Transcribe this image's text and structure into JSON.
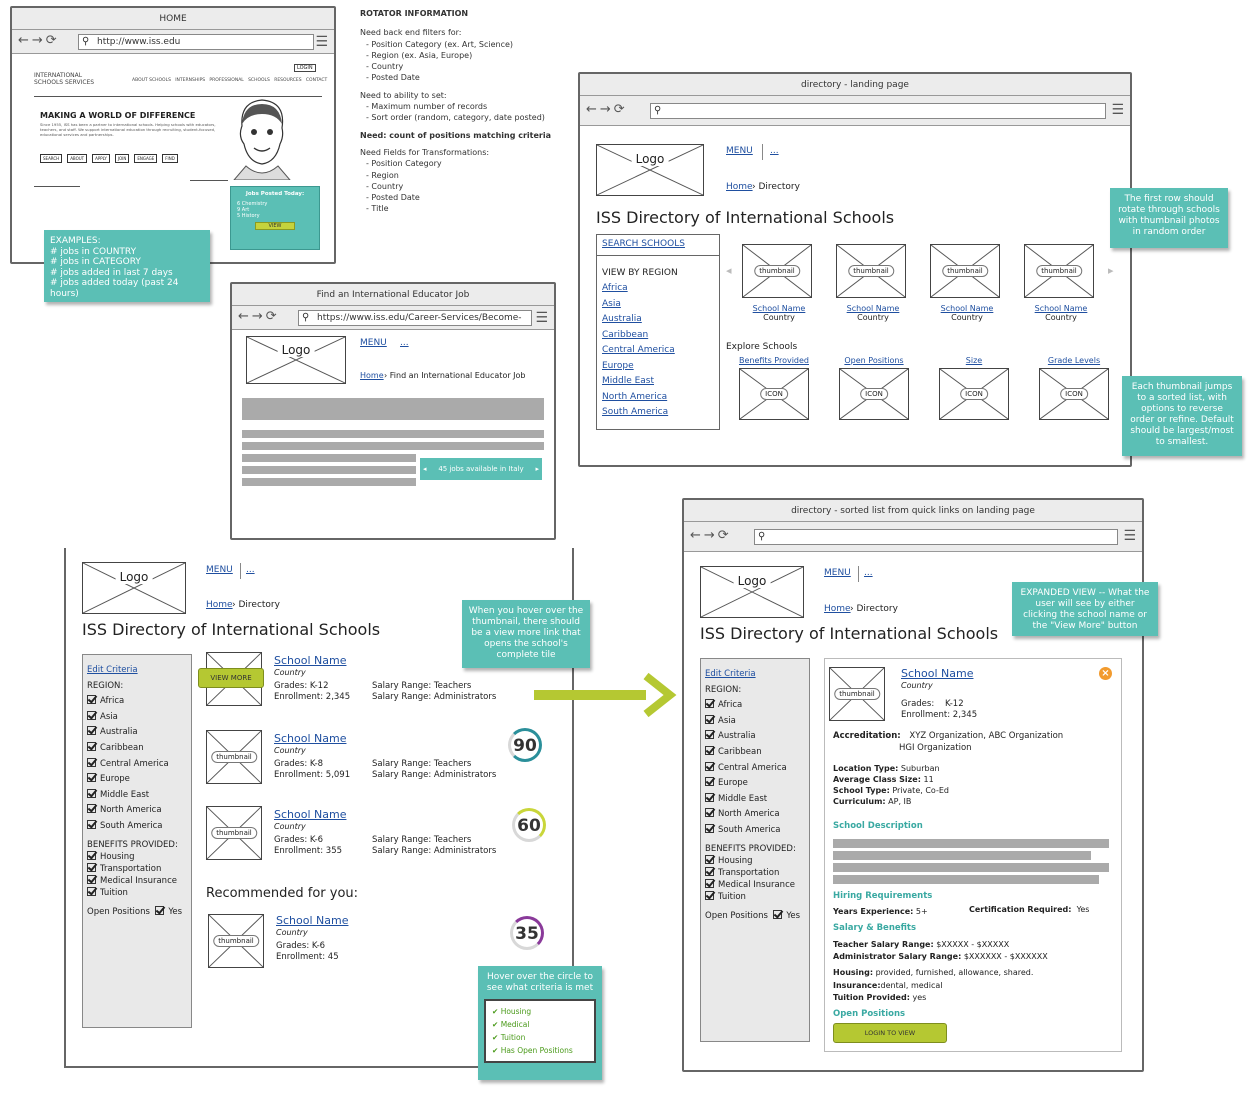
{
  "home": {
    "title": "HOME",
    "url": "http://www.iss.edu",
    "logo_line1": "INTERNATIONAL",
    "logo_line2": "SCHOOLS SERVICES",
    "login": "LOGIN",
    "nav": "ABOUT SCHOOLS   INTERNSHIPS   PROFESSIONAL   SCHOOLS   RESOURCES   CONTACT",
    "hero_title": "MAKING A WORLD OF DIFFERENCE",
    "hero_text": "Since 1955, ISS has been a partner to international schools. Helping schools with educators, teachers, and staff. We support international education through recruiting, student-focused, educational services and partnerships.",
    "pills": [
      "SEARCH",
      "ABOUT",
      "APPLY",
      "JOIN",
      "ENGAGE",
      "FIND"
    ],
    "jobs_title": "Jobs Posted Today:",
    "jobs": [
      "6 Chemistry",
      "9 Art",
      "5 History"
    ],
    "view": "VIEW",
    "examples": [
      "EXAMPLES:",
      "# jobs in COUNTRY",
      "# jobs in CATEGORY",
      "# jobs added in last 7 days",
      "# jobs added today (past 24 hours)"
    ]
  },
  "rotator": {
    "title": "ROTATOR INFORMATION",
    "g1": "Need back end filters for:",
    "g1_items": [
      "- Position Category (ex. Art, Science)",
      "- Region (ex. Asia, Europe)",
      "- Country",
      "- Posted Date"
    ],
    "g2": "Need to ability to set:",
    "g2_items": [
      "- Maximum number of records",
      "- Sort order (random, category, date posted)"
    ],
    "g3": "Need: count of positions matching criteria",
    "g4": "Need Fields for Transformations:",
    "g4_items": [
      "- Position Category",
      "- Region",
      "- Country",
      "- Posted Date",
      "- Title"
    ]
  },
  "job": {
    "title": "Find an International Educator Job",
    "url": "https://www.iss.edu/Career-Services/Become-",
    "logo": "Logo",
    "menu": "MENU",
    "dots": "...",
    "home": "Home",
    "crumb": "Find an International Educator Job",
    "rotator": "45 jobs available in Italy"
  },
  "landing": {
    "title": "directory - landing page",
    "logo": "Logo",
    "menu": "MENU",
    "dots": "...",
    "home": "Home",
    "crumb": "Directory",
    "heading": "ISS Directory of International Schools",
    "search": "SEARCH SCHOOLS",
    "view_by": "VIEW BY REGION",
    "regions": [
      "Africa",
      "Asia",
      "Australia",
      "Caribbean",
      "Central America",
      "Europe",
      "Middle East",
      "North America",
      "South America"
    ],
    "thumb": "thumbnail",
    "school": "School Name",
    "country": "Country",
    "explore": "Explore Schools",
    "explore_links": [
      "Benefits Provided",
      "Open Positions",
      "Size",
      "Grade Levels"
    ],
    "icon": "ICON",
    "note1": "The first row should rotate through schools with thumbnail photos in random order",
    "note2": "Each thumbnail jumps to a sorted list, with options to reverse order or refine. Default should be largest/most to smallest."
  },
  "list": {
    "logo": "Logo",
    "menu": "MENU",
    "dots": "...",
    "home": "Home",
    "crumb": "Directory",
    "heading": "ISS Directory of International Schools",
    "edit": "Edit Criteria",
    "region_label": "REGION:",
    "regions": [
      "Africa",
      "Asia",
      "Australia",
      "Caribbean",
      "Central America",
      "Europe",
      "Middle East",
      "North America",
      "South America"
    ],
    "benefits_label": "BENEFITS PROVIDED:",
    "benefits": [
      "Housing",
      "Transportation",
      "Medical Insurance",
      "Tuition"
    ],
    "open_positions": "Open Positions",
    "yes": "Yes",
    "view_more": "VIEW MORE",
    "thumb": "thumbnail",
    "results": [
      {
        "name": "School Name",
        "country": "Country",
        "grades": "Grades: K-12",
        "enrollment": "Enrollment: 2,345",
        "sal1": "Salary Range: Teachers",
        "sal2": "Salary Range: Administrators",
        "score": ""
      },
      {
        "name": "School Name",
        "country": "Country",
        "grades": "Grades: K-8",
        "enrollment": "Enrollment: 5,091",
        "sal1": "Salary Range: Teachers",
        "sal2": "Salary Range: Administrators",
        "score": "90"
      },
      {
        "name": "School Name",
        "country": "Country",
        "grades": "Grades: K-6",
        "enrollment": "Enrollment: 355",
        "sal1": "Salary Range: Teachers",
        "sal2": "Salary Range: Administrators",
        "score": "60"
      }
    ],
    "recommended": "Recommended for you:",
    "rec": {
      "name": "School Name",
      "country": "Country",
      "grades": "Grades: K-6",
      "enrollment": "Enrollment: 45",
      "score": "35"
    },
    "hover_note": "When you hover over the thumbnail, there should be a view more link that opens the school's complete tile",
    "circle_note": "Hover over the circle to see what criteria is met",
    "criteria": [
      "Housing",
      "Medical",
      "Tuition",
      "Has Open Positions"
    ],
    "ring_colors": {
      "90": "#2a8f9a",
      "60": "#c9d63a",
      "35": "#8a3a9a"
    }
  },
  "expanded": {
    "title": "directory - sorted list from quick links on landing page",
    "logo": "Logo",
    "menu": "MENU",
    "dots": "...",
    "home": "Home",
    "crumb": "Directory",
    "heading": "ISS Directory of International Schools",
    "edit": "Edit Criteria",
    "region_label": "REGION:",
    "regions": [
      "Africa",
      "Asia",
      "Australia",
      "Caribbean",
      "Central America",
      "Europe",
      "Middle East",
      "North America",
      "South America"
    ],
    "benefits_label": "BENEFITS PROVIDED:",
    "benefits": [
      "Housing",
      "Transportation",
      "Medical Insurance",
      "Tuition"
    ],
    "open_positions": "Open Positions",
    "yes": "Yes",
    "note": "EXPANDED VIEW -- What the user will see by either clicking the school name or the \"View More\" button",
    "thumb": "thumbnail",
    "name": "School Name",
    "country": "Country",
    "grades_l": "Grades:",
    "grades_v": "K-12",
    "enrollment": "Enrollment: 2,345",
    "accr_l": "Accreditation:",
    "accr_v1": "XYZ Organization, ABC Organization",
    "accr_v2": "HGI Organization",
    "loc_l": "Location Type:",
    "loc_v": "Suburban",
    "acs_l": "Average Class Size:",
    "acs_v": "11",
    "st_l": "School Type:",
    "st_v": "Private, Co-Ed",
    "cur_l": "Curriculum:",
    "cur_v": "AP, IB",
    "desc": "School Description",
    "hiring": "Hiring Requirements",
    "yexp_l": "Years Experience:",
    "yexp_v": "5+",
    "cert_l": "Certification Required:",
    "cert_v": "Yes",
    "salben": "Salary & Benefits",
    "tsal_l": "Teacher Salary Range:",
    "tsal_v": "$XXXXX - $XXXXX",
    "asal_l": "Administrator Salary Range:",
    "asal_v": "$XXXXXX - $XXXXXX",
    "hous_l": "Housing:",
    "hous_v": "provided, furnished, allowance, shared.",
    "ins_l": "Insurance:",
    "ins_v": "dental, medical",
    "tui_l": "Tuition Provided:",
    "tui_v": "yes",
    "openpos": "Open Positions",
    "login": "LOGIN TO VIEW"
  },
  "colors": {
    "teal": "#5bbfb5",
    "lime": "#b5c832",
    "link": "#1f4fa0"
  }
}
